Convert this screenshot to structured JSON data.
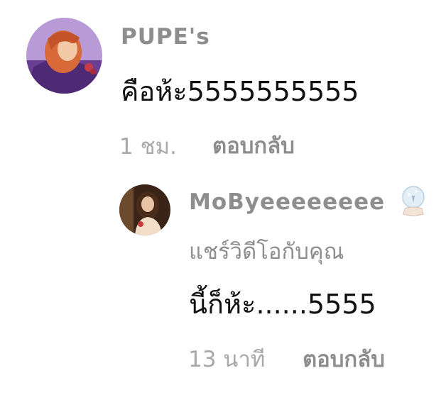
{
  "comments": [
    {
      "username": "PUPE's",
      "text": "คือห้ะ5555555555",
      "time": "1 ชม.",
      "reply_label": "ตอบกลับ"
    },
    {
      "username": "MoByeeeeeeee",
      "subtext": "แชร์วิดีโอกับคุณ",
      "text": "นี้ก็ห้ะ......5555",
      "time": "13 นาที",
      "reply_label": "ตอบกลับ"
    }
  ],
  "colors": {
    "username": "#8e8e8e",
    "text": "#111111",
    "meta": "#a8a8a8"
  },
  "icons": {
    "badge": "snowglobe-emoji-icon"
  }
}
